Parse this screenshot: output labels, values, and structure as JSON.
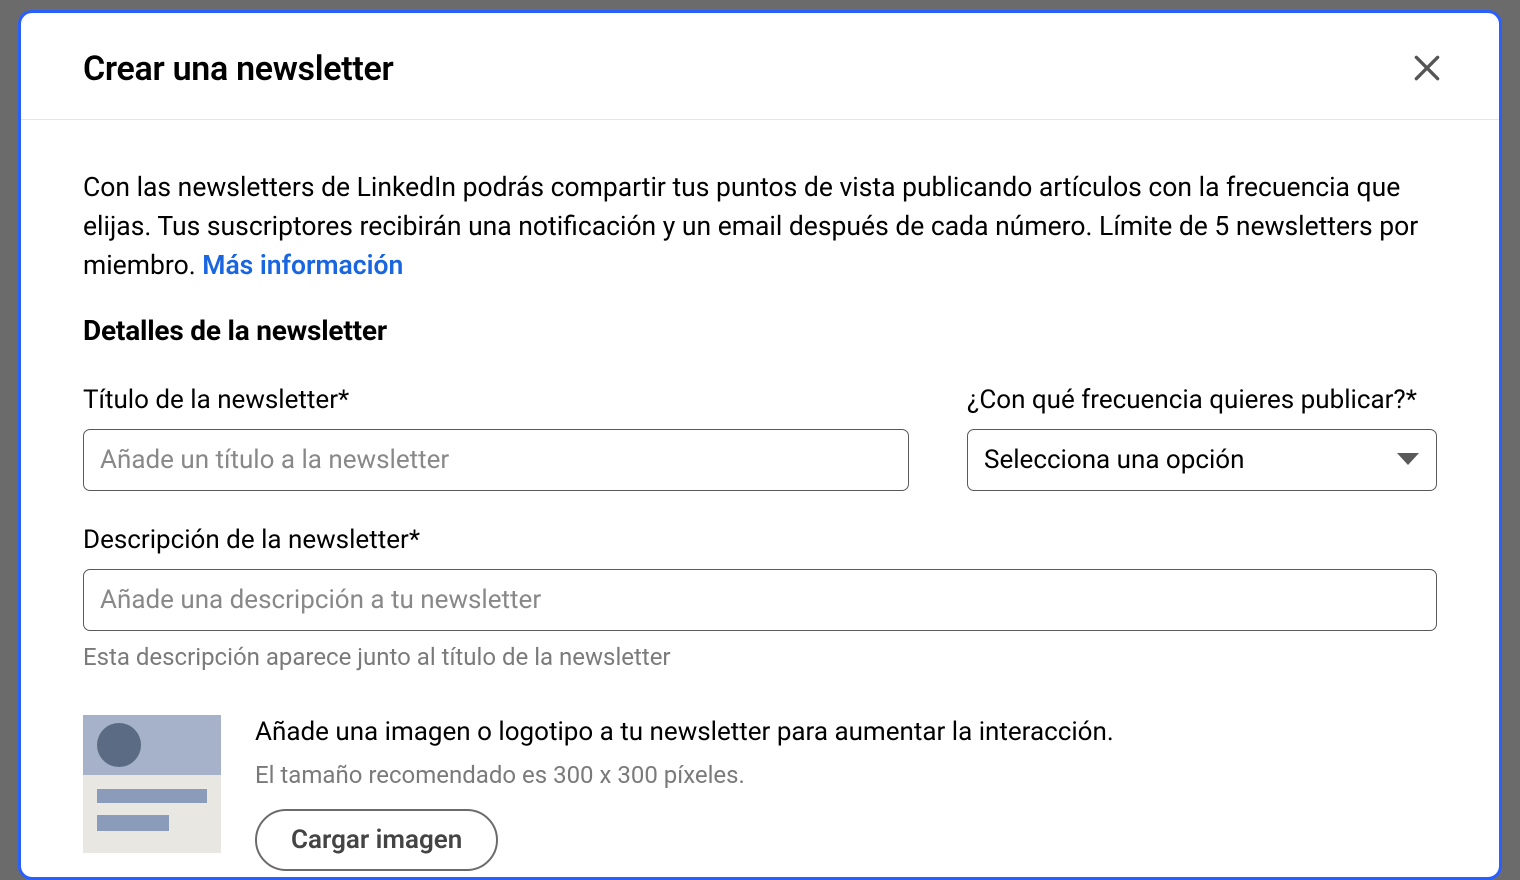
{
  "modal": {
    "title": "Crear una newsletter",
    "intro_text": "Con las newsletters de LinkedIn podrás compartir tus puntos de vista publicando artículos con la frecuencia que elijas. Tus suscriptores recibirán una notificación y un email después de cada número. Límite de 5 newsletters por miembro. ",
    "intro_link": "Más información",
    "section_title": "Detalles de la newsletter",
    "fields": {
      "title_label": "Título de la newsletter*",
      "title_placeholder": "Añade un título a la newsletter",
      "frequency_label": "¿Con qué frecuencia quieres publicar?*",
      "frequency_selected": "Selecciona una opción",
      "description_label": "Descripción de la newsletter*",
      "description_placeholder": "Añade una descripción a tu newsletter",
      "description_helper": "Esta descripción aparece junto al título de la newsletter"
    },
    "image_upload": {
      "title": "Añade una imagen o logotipo a tu newsletter para aumentar la interacción.",
      "subtitle": "El tamaño recomendado es 300 x 300 píxeles.",
      "button_label": "Cargar imagen"
    }
  }
}
